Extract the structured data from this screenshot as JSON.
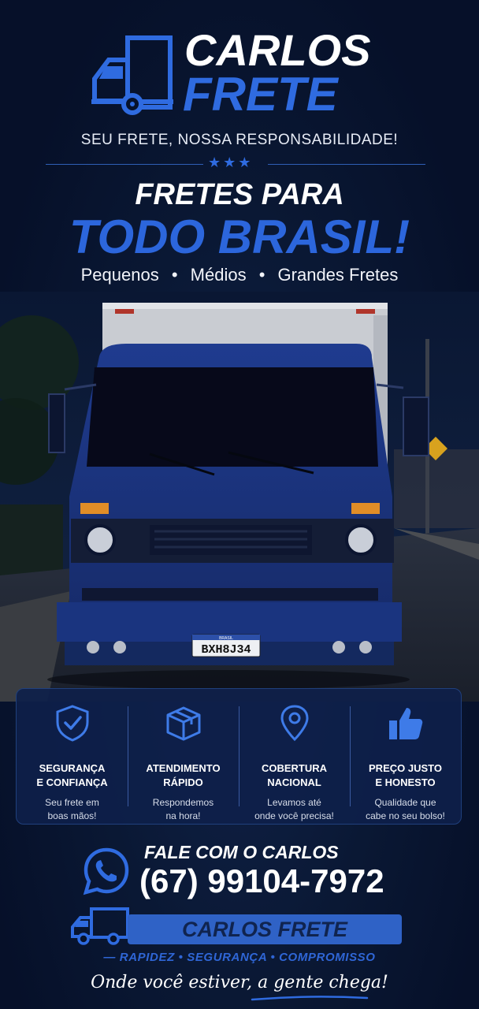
{
  "brand": {
    "name_line_1": "CARLOS",
    "name_line_2": "FRETE",
    "tagline": "SEU FRETE, NOSSA RESPONSABILIDADE!",
    "stars": "★★★"
  },
  "headline": {
    "line_1": "FRETES PARA",
    "line_2": "TODO BRASIL!"
  },
  "sizes": {
    "items": [
      "Pequenos",
      "Médios",
      "Grandes Fretes"
    ],
    "separator": "•"
  },
  "truck": {
    "plate_country": "BRASIL",
    "plate": "BXH8J34"
  },
  "features": [
    {
      "icon": "shield-check-icon",
      "title": "SEGURANÇA\nE CONFIANÇA",
      "desc": "Seu frete em\nboas mãos!"
    },
    {
      "icon": "box-icon",
      "title": "ATENDIMENTO\nRÁPIDO",
      "desc": "Respondemos\nna hora!"
    },
    {
      "icon": "location-pin-icon",
      "title": "COBERTURA\nNACIONAL",
      "desc": "Levamos até\nonde você precisa!"
    },
    {
      "icon": "thumbs-up-icon",
      "title": "PREÇO JUSTO\nE HONESTO",
      "desc": "Qualidade que\ncabe no seu bolso!"
    }
  ],
  "contact": {
    "label": "FALE COM O CARLOS",
    "phone": "(67) 99104-7972",
    "icon": "whatsapp-icon"
  },
  "footer": {
    "banner": "CARLOS FRETE",
    "values": "— RAPIDEZ • SEGURANÇA • COMPROMISSO",
    "slogan": "Onde você estiver, a gente chega!"
  },
  "colors": {
    "background": "#07122b",
    "accent": "#2f6be0",
    "truck": "#1f3a8f",
    "panel": "#0e204a"
  }
}
